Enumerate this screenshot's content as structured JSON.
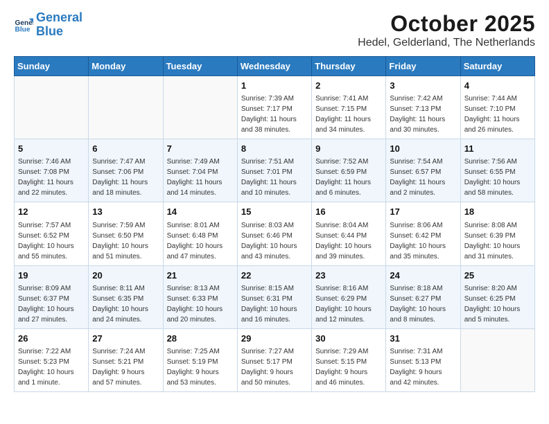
{
  "header": {
    "logo_line1": "General",
    "logo_line2": "Blue",
    "month": "October 2025",
    "location": "Hedel, Gelderland, The Netherlands"
  },
  "weekdays": [
    "Sunday",
    "Monday",
    "Tuesday",
    "Wednesday",
    "Thursday",
    "Friday",
    "Saturday"
  ],
  "weeks": [
    [
      {
        "day": "",
        "detail": ""
      },
      {
        "day": "",
        "detail": ""
      },
      {
        "day": "",
        "detail": ""
      },
      {
        "day": "1",
        "detail": "Sunrise: 7:39 AM\nSunset: 7:17 PM\nDaylight: 11 hours\nand 38 minutes."
      },
      {
        "day": "2",
        "detail": "Sunrise: 7:41 AM\nSunset: 7:15 PM\nDaylight: 11 hours\nand 34 minutes."
      },
      {
        "day": "3",
        "detail": "Sunrise: 7:42 AM\nSunset: 7:13 PM\nDaylight: 11 hours\nand 30 minutes."
      },
      {
        "day": "4",
        "detail": "Sunrise: 7:44 AM\nSunset: 7:10 PM\nDaylight: 11 hours\nand 26 minutes."
      }
    ],
    [
      {
        "day": "5",
        "detail": "Sunrise: 7:46 AM\nSunset: 7:08 PM\nDaylight: 11 hours\nand 22 minutes."
      },
      {
        "day": "6",
        "detail": "Sunrise: 7:47 AM\nSunset: 7:06 PM\nDaylight: 11 hours\nand 18 minutes."
      },
      {
        "day": "7",
        "detail": "Sunrise: 7:49 AM\nSunset: 7:04 PM\nDaylight: 11 hours\nand 14 minutes."
      },
      {
        "day": "8",
        "detail": "Sunrise: 7:51 AM\nSunset: 7:01 PM\nDaylight: 11 hours\nand 10 minutes."
      },
      {
        "day": "9",
        "detail": "Sunrise: 7:52 AM\nSunset: 6:59 PM\nDaylight: 11 hours\nand 6 minutes."
      },
      {
        "day": "10",
        "detail": "Sunrise: 7:54 AM\nSunset: 6:57 PM\nDaylight: 11 hours\nand 2 minutes."
      },
      {
        "day": "11",
        "detail": "Sunrise: 7:56 AM\nSunset: 6:55 PM\nDaylight: 10 hours\nand 58 minutes."
      }
    ],
    [
      {
        "day": "12",
        "detail": "Sunrise: 7:57 AM\nSunset: 6:52 PM\nDaylight: 10 hours\nand 55 minutes."
      },
      {
        "day": "13",
        "detail": "Sunrise: 7:59 AM\nSunset: 6:50 PM\nDaylight: 10 hours\nand 51 minutes."
      },
      {
        "day": "14",
        "detail": "Sunrise: 8:01 AM\nSunset: 6:48 PM\nDaylight: 10 hours\nand 47 minutes."
      },
      {
        "day": "15",
        "detail": "Sunrise: 8:03 AM\nSunset: 6:46 PM\nDaylight: 10 hours\nand 43 minutes."
      },
      {
        "day": "16",
        "detail": "Sunrise: 8:04 AM\nSunset: 6:44 PM\nDaylight: 10 hours\nand 39 minutes."
      },
      {
        "day": "17",
        "detail": "Sunrise: 8:06 AM\nSunset: 6:42 PM\nDaylight: 10 hours\nand 35 minutes."
      },
      {
        "day": "18",
        "detail": "Sunrise: 8:08 AM\nSunset: 6:39 PM\nDaylight: 10 hours\nand 31 minutes."
      }
    ],
    [
      {
        "day": "19",
        "detail": "Sunrise: 8:09 AM\nSunset: 6:37 PM\nDaylight: 10 hours\nand 27 minutes."
      },
      {
        "day": "20",
        "detail": "Sunrise: 8:11 AM\nSunset: 6:35 PM\nDaylight: 10 hours\nand 24 minutes."
      },
      {
        "day": "21",
        "detail": "Sunrise: 8:13 AM\nSunset: 6:33 PM\nDaylight: 10 hours\nand 20 minutes."
      },
      {
        "day": "22",
        "detail": "Sunrise: 8:15 AM\nSunset: 6:31 PM\nDaylight: 10 hours\nand 16 minutes."
      },
      {
        "day": "23",
        "detail": "Sunrise: 8:16 AM\nSunset: 6:29 PM\nDaylight: 10 hours\nand 12 minutes."
      },
      {
        "day": "24",
        "detail": "Sunrise: 8:18 AM\nSunset: 6:27 PM\nDaylight: 10 hours\nand 8 minutes."
      },
      {
        "day": "25",
        "detail": "Sunrise: 8:20 AM\nSunset: 6:25 PM\nDaylight: 10 hours\nand 5 minutes."
      }
    ],
    [
      {
        "day": "26",
        "detail": "Sunrise: 7:22 AM\nSunset: 5:23 PM\nDaylight: 10 hours\nand 1 minute."
      },
      {
        "day": "27",
        "detail": "Sunrise: 7:24 AM\nSunset: 5:21 PM\nDaylight: 9 hours\nand 57 minutes."
      },
      {
        "day": "28",
        "detail": "Sunrise: 7:25 AM\nSunset: 5:19 PM\nDaylight: 9 hours\nand 53 minutes."
      },
      {
        "day": "29",
        "detail": "Sunrise: 7:27 AM\nSunset: 5:17 PM\nDaylight: 9 hours\nand 50 minutes."
      },
      {
        "day": "30",
        "detail": "Sunrise: 7:29 AM\nSunset: 5:15 PM\nDaylight: 9 hours\nand 46 minutes."
      },
      {
        "day": "31",
        "detail": "Sunrise: 7:31 AM\nSunset: 5:13 PM\nDaylight: 9 hours\nand 42 minutes."
      },
      {
        "day": "",
        "detail": ""
      }
    ]
  ]
}
